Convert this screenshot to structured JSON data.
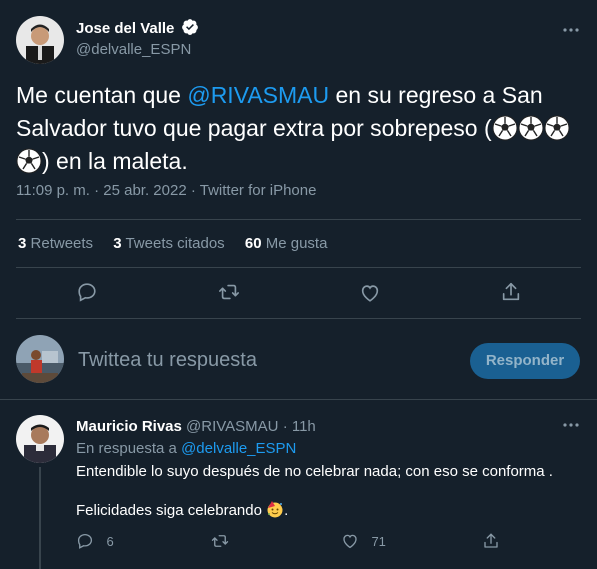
{
  "tweet": {
    "author_name": "Jose del Valle",
    "author_handle": "@delvalle_ESPN",
    "text_before_mention": "Me cuentan que ",
    "mention": "@RIVASMAU",
    "text_after_mention": " en su regreso a San Salvador tuvo que pagar extra por sobrepeso (",
    "text_end": ") en la maleta.",
    "emoji_count": 4,
    "timestamp": "11:09 p. m. · 25 abr. 2022 · Twitter for iPhone",
    "stats": {
      "retweets_count": "3",
      "retweets_label": "Retweets",
      "quotes_count": "3",
      "quotes_label": "Tweets citados",
      "likes_count": "60",
      "likes_label": "Me gusta"
    }
  },
  "compose": {
    "placeholder": "Twittea tu respuesta",
    "reply_button": "Responder"
  },
  "reply": {
    "author_name": "Mauricio Rivas",
    "author_handle": "@RIVASMAU",
    "time": "· 11h",
    "replying_to_prefix": "En respuesta a ",
    "replying_to_handle": "@delvalle_ESPN",
    "line1": "Entendible lo suyo después de no celebrar nada; con eso se conforma .",
    "line2_before_emoji": "Felicidades siga celebrando ",
    "line2_after_emoji": ".",
    "reply_count": "6",
    "like_count": "71"
  },
  "colors": {
    "background": "#15202b",
    "accent": "#1d9bf0",
    "muted": "#8899a6",
    "divider": "#38444d"
  },
  "icons": [
    "verified-badge-icon",
    "more-icon",
    "reply-icon",
    "retweet-icon",
    "like-icon",
    "share-icon",
    "soccer-ball-icon",
    "party-face-icon"
  ]
}
